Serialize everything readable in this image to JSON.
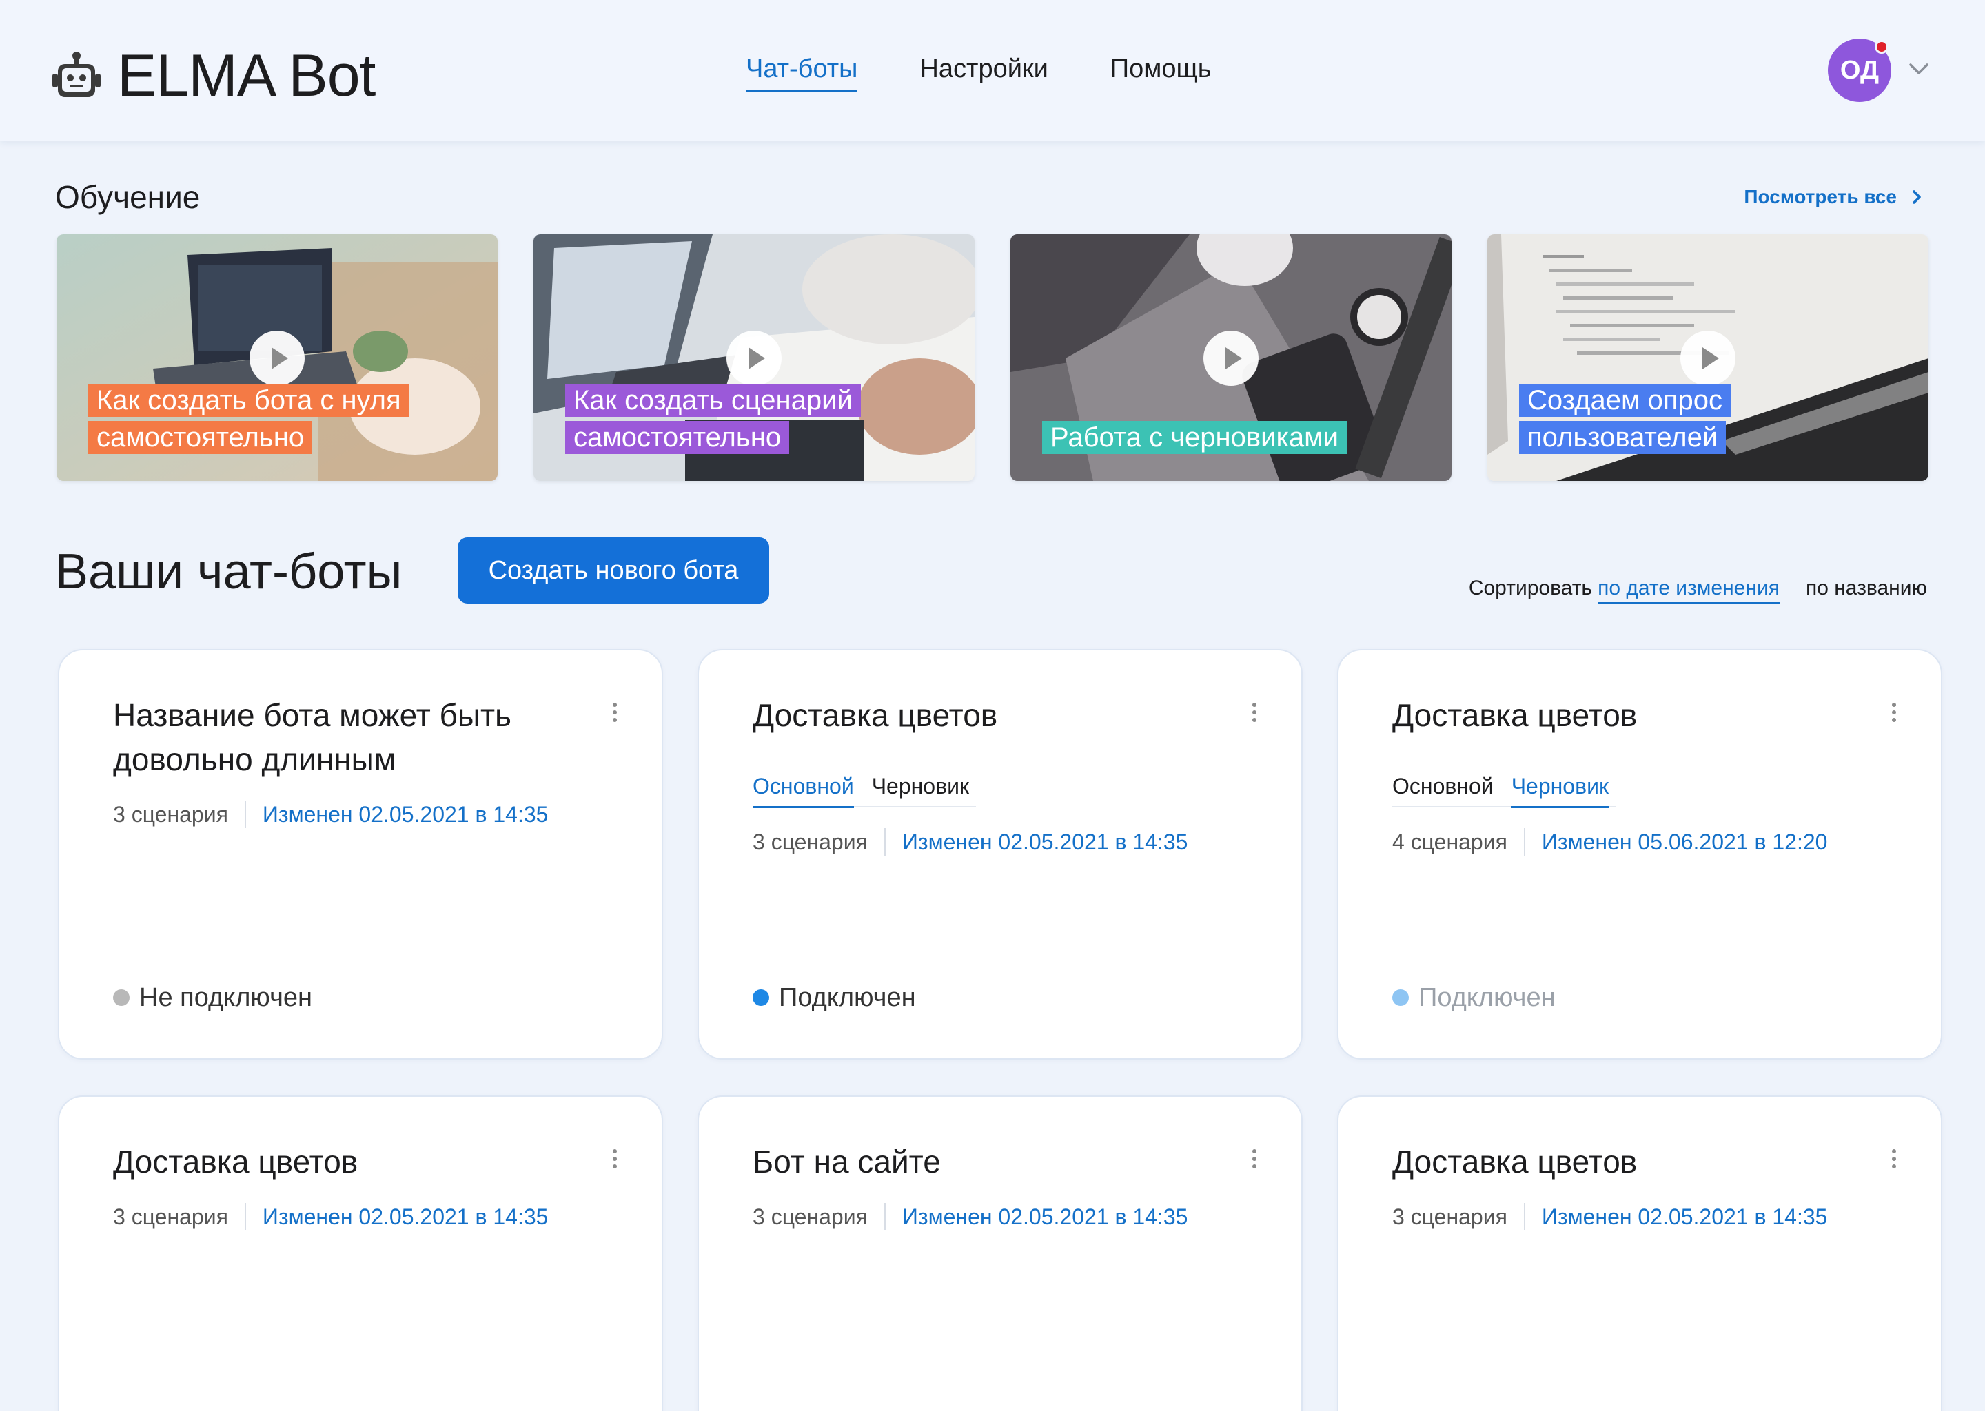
{
  "app": {
    "name": "ELMA Bot"
  },
  "nav": [
    {
      "label": "Чат-боты",
      "active": true
    },
    {
      "label": "Настройки",
      "active": false
    },
    {
      "label": "Помощь",
      "active": false
    }
  ],
  "user": {
    "initials": "ОД",
    "avatar_color": "#8e57dc",
    "notification_color": "#e0202a"
  },
  "training": {
    "title": "Обучение",
    "view_all": "Посмотреть все",
    "videos": [
      {
        "lines": [
          "Как создать бота с нуля",
          "самостоятельно"
        ],
        "label_color": "#f47a45"
      },
      {
        "lines": [
          "Как создать сценарий",
          "самостоятельно"
        ],
        "label_color": "#9b59d9"
      },
      {
        "lines": [
          "Работа с черновиками"
        ],
        "label_color": "#3cc2b4"
      },
      {
        "lines": [
          "Создаем опрос",
          "пользователей"
        ],
        "label_color": "#4a7df0"
      }
    ]
  },
  "bots": {
    "title": "Ваши чат-боты",
    "create_label": "Создать нового бота",
    "sort": {
      "label": "Сортировать",
      "options": [
        "по дате изменения",
        "по названию"
      ],
      "active": 0
    },
    "tab_labels": [
      "Основной",
      "Черновик"
    ],
    "items": [
      {
        "name": "Название бота может быть довольно длинным",
        "scenarios": "3 сценария",
        "modified": "Изменен 02.05.2021 в 14:35",
        "tabs": null,
        "status": "Не подключен",
        "status_kind": "off"
      },
      {
        "name": "Доставка цветов",
        "scenarios": "3 сценария",
        "modified": "Изменен 02.05.2021 в 14:35",
        "tabs": 0,
        "status": "Подключен",
        "status_kind": "on"
      },
      {
        "name": "Доставка цветов",
        "scenarios": "4 сценария",
        "modified": "Изменен 05.06.2021 в 12:20",
        "tabs": 1,
        "status": "Подключен",
        "status_kind": "faded"
      },
      {
        "name": "Доставка цветов",
        "scenarios": "3 сценария",
        "modified": "Изменен 02.05.2021 в 14:35",
        "tabs": null,
        "status": null,
        "status_kind": null
      },
      {
        "name": "Бот на сайте",
        "scenarios": "3 сценария",
        "modified": "Изменен 02.05.2021 в 14:35",
        "tabs": null,
        "status": null,
        "status_kind": null
      },
      {
        "name": "Доставка цветов",
        "scenarios": "3 сценария",
        "modified": "Изменен 02.05.2021 в 14:35",
        "tabs": null,
        "status": null,
        "status_kind": null
      }
    ]
  },
  "colors": {
    "accent": "#1470c8",
    "button": "#1470d8",
    "status_on": "#1e88e5",
    "status_off": "#b8b8b8",
    "status_faded": "#8ec5f3"
  }
}
